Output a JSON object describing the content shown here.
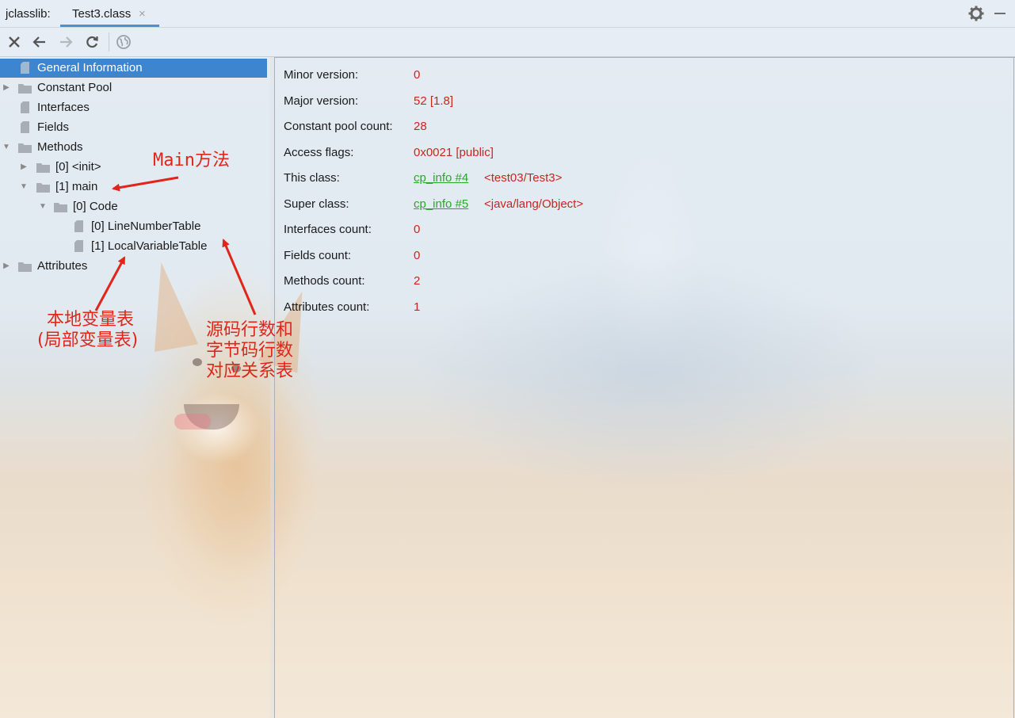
{
  "titlebar": {
    "app_label": "jclasslib:",
    "tab_label": "Test3.class",
    "tab_close": "×",
    "accent_color": "#4b8fd4"
  },
  "toolbar": {
    "buttons": [
      "close-icon",
      "back-arrow-icon",
      "forward-arrow-icon",
      "refresh-icon",
      "web-globe-icon"
    ]
  },
  "tree": {
    "general_information": "General Information",
    "constant_pool": "Constant Pool",
    "interfaces": "Interfaces",
    "fields": "Fields",
    "methods": "Methods",
    "method_init": "[0] <init>",
    "method_main": "[1] main",
    "code": "[0] Code",
    "line_number_table": "[0] LineNumberTable",
    "local_variable_table": "[1] LocalVariableTable",
    "attributes": "Attributes",
    "selected_color": "#3d85cf"
  },
  "general_info": {
    "minor_version_label": "Minor version:",
    "minor_version_value": "0",
    "major_version_label": "Major version:",
    "major_version_value": "52 [1.8]",
    "constant_pool_count_label": "Constant pool count:",
    "constant_pool_count_value": "28",
    "access_flags_label": "Access flags:",
    "access_flags_value": "0x0021 [public]",
    "this_class_label": "This class:",
    "this_class_link": "cp_info #4",
    "this_class_value": "<test03/Test3>",
    "super_class_label": "Super class:",
    "super_class_link": "cp_info #5",
    "super_class_value": "<java/lang/Object>",
    "interfaces_count_label": "Interfaces count:",
    "interfaces_count_value": "0",
    "fields_count_label": "Fields count:",
    "fields_count_value": "0",
    "methods_count_label": "Methods count:",
    "methods_count_value": "2",
    "attributes_count_label": "Attributes count:",
    "attributes_count_value": "1",
    "value_color": "#c8251e",
    "link_color": "#2aa62a"
  },
  "annotations": {
    "main_method": "Main方法",
    "local_var_line1": "本地变量表",
    "local_var_line2": "(局部变量表)",
    "line_num_line1": "源码行数和",
    "line_num_line2": "字节码行数",
    "line_num_line3": "对应关系表",
    "color": "#e0261b"
  }
}
